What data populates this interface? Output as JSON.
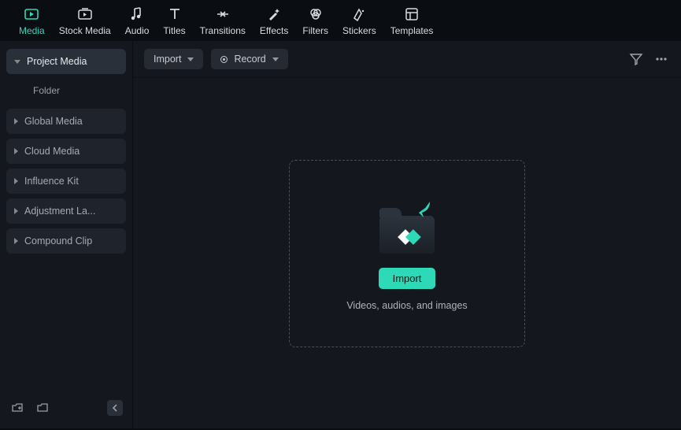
{
  "topTabs": [
    {
      "label": "Media",
      "name": "tab-media",
      "active": true
    },
    {
      "label": "Stock Media",
      "name": "tab-stock-media"
    },
    {
      "label": "Audio",
      "name": "tab-audio"
    },
    {
      "label": "Titles",
      "name": "tab-titles"
    },
    {
      "label": "Transitions",
      "name": "tab-transitions"
    },
    {
      "label": "Effects",
      "name": "tab-effects"
    },
    {
      "label": "Filters",
      "name": "tab-filters"
    },
    {
      "label": "Stickers",
      "name": "tab-stickers"
    },
    {
      "label": "Templates",
      "name": "tab-templates"
    }
  ],
  "sidebar": {
    "items": [
      {
        "label": "Project Media",
        "name": "sidebar-item-project-media",
        "active": true,
        "expanded": true
      },
      {
        "label": "Global Media",
        "name": "sidebar-item-global-media"
      },
      {
        "label": "Cloud Media",
        "name": "sidebar-item-cloud-media"
      },
      {
        "label": "Influence Kit",
        "name": "sidebar-item-influence-kit"
      },
      {
        "label": "Adjustment La...",
        "name": "sidebar-item-adjustment-layer"
      },
      {
        "label": "Compound Clip",
        "name": "sidebar-item-compound-clip"
      }
    ],
    "folderLabel": "Folder"
  },
  "toolbar": {
    "importLabel": "Import",
    "recordLabel": "Record"
  },
  "dropzone": {
    "importButton": "Import",
    "hint": "Videos, audios, and images"
  },
  "colors": {
    "accent": "#2ed9b8"
  }
}
